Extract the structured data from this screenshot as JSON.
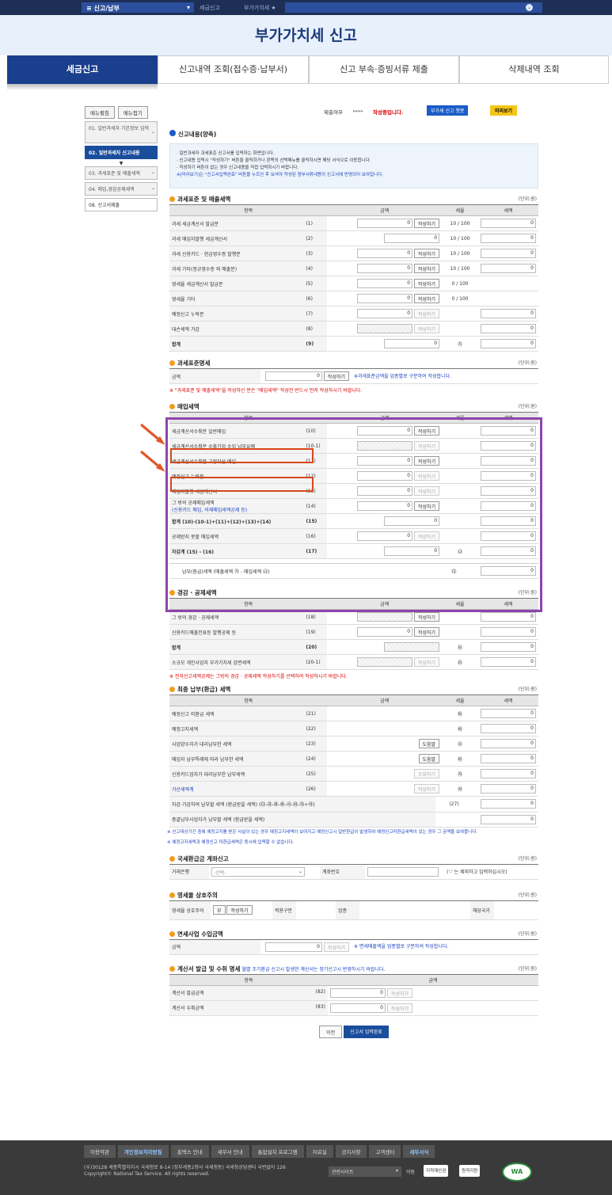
{
  "topbar": {
    "menu": "≡ 신고/납부",
    "crumb1": "세금신고",
    "crumb2": "부가가치세 ★"
  },
  "hero": {
    "title": "부가가치세 신고"
  },
  "tabs": [
    "세금신고",
    "신고내역 조회(접수증·납부서)",
    "신고 부속·증빙서류 제출",
    "삭제내역 조회"
  ],
  "leftnav": {
    "open": "메뉴펼침",
    "close": "메뉴접기",
    "items": [
      "01. 일반과세자 기본정보 입력",
      "02. 일반과세자 신고내용",
      "03. 과세표준 및 매출세액",
      "04. 매입,경감공제세액",
      "08. 신고서제출"
    ]
  },
  "status": {
    "label": "제출여부",
    "progress": "▸▸▸▸",
    "state": "작성중입니다.",
    "chatbot": "부가세 신고 챗봇",
    "preview": "미리보기"
  },
  "intro": {
    "title": "신고내용(양축)",
    "lines": [
      "· 일반과세자 과세표준 신고서를 입력하는 화면입니다.",
      "· 신고내용 입력시 \"작성하기\" 버튼을 클릭하거나 왼쪽의 선택메뉴를 클릭하시면 해당 서식으로 이동합니다.",
      "· 작성하기 버튼이 없는 경우 신고내용을 직접 입력하시기 바랍니다.",
      "※[미리보기]는 \"신고서입력완료\" 버튼을 누르신 후 보셔야 작성된 첨부서류내용이 신고서에 반영되어 보여집니다."
    ]
  },
  "unit": "(단위:원)",
  "headers": {
    "item": "항목",
    "amount": "금액",
    "rate": "세율",
    "tax": "세액"
  },
  "write": "작성하기",
  "help": "도움말",
  "inquire": "조회하기",
  "s1": {
    "title": "과세표준 및 매출세액",
    "rows": [
      [
        "과세 세금계산서 발급분",
        "(1)",
        "0",
        "w",
        "10 / 100",
        "0"
      ],
      [
        "과세 매입자발행 세금계산서",
        "(2)",
        "0",
        "",
        "10 / 100",
        "0"
      ],
      [
        "과세 신용카드 · 현금영수증 발행분",
        "(3)",
        "0",
        "w",
        "10 / 100",
        "0"
      ],
      [
        "과세 기타(정규영수증 외 매출분)",
        "(4)",
        "0",
        "w",
        "10 / 100",
        "0"
      ],
      [
        "영세율 세금계산서 발급분",
        "(5)",
        "0",
        "w",
        "0 / 100",
        ""
      ],
      [
        "영세율 기타",
        "(6)",
        "0",
        "w",
        "0 / 100",
        ""
      ],
      [
        "예정신고 누락분",
        "(7)",
        "0",
        "d",
        "",
        "0"
      ],
      [
        "대손세액 가감",
        "(8)",
        "",
        "d",
        "",
        "0"
      ],
      [
        "합계",
        "(9)",
        "0",
        "",
        "㉮",
        "0"
      ]
    ]
  },
  "s2": {
    "title": "과세표준명세",
    "label": "금액",
    "value": "0",
    "note": "※과세표준금액을 업종별로 구분하여 작성합니다.",
    "warn": "※ \"과세표준 및 매출세액\"을 작성하신 분은 \"매입세액\" 작성전 반드시 먼저 작성하시기 바랍니다."
  },
  "s3": {
    "title": "매입세액",
    "rows": [
      [
        "세금계산서수취분 일반매입",
        "(10)",
        "0",
        "w",
        "",
        "0"
      ],
      [
        "세금계산서수취분 수출기업 수입 납부유예",
        "(10-1)",
        "",
        "d",
        "",
        "0"
      ],
      [
        "세금계산서수취분 고정자산 매입",
        "(11)",
        "0",
        "w",
        "",
        "0"
      ],
      [
        "예정신고 누락분",
        "(12)",
        "0",
        "d",
        "",
        "0"
      ],
      [
        "매입자발행 세금계산서",
        "(13)",
        "0",
        "d",
        "",
        "0"
      ],
      [
        "그 밖의 공제매입세액",
        "(14)",
        "0",
        "w",
        "",
        "0"
      ],
      [
        "합계 (10)-(10-1)+(11)+(12)+(13)+(14)",
        "(15)",
        "0",
        "",
        "",
        "0"
      ],
      [
        "공제받지 못할 매입세액",
        "(16)",
        "0",
        "d",
        "",
        "0"
      ],
      [
        "차감계 (15) - (16)",
        "(17)",
        "0",
        "",
        "㉯",
        "0"
      ]
    ],
    "sub14": "(신용카드 매입, 의제매입세액공제 등)",
    "pay": "납부(환급)세액 (매출세액 ㉮ - 매입세액 ㉯)",
    "pay_mark": "㉰",
    "pay_val": "0"
  },
  "s4": {
    "title": "경감 · 공제세액",
    "rows": [
      [
        "그 밖의 경감 · 공제세액",
        "(18)",
        "",
        "w",
        "",
        "0"
      ],
      [
        "신용카드매출전표등 발행공제 등",
        "(19)",
        "0",
        "w",
        "",
        "0"
      ],
      [
        "합계",
        "(20)",
        "",
        "",
        "㉱",
        "0"
      ],
      [
        "소규모 개인사업자 부가가치세 감면세액",
        "(20-1)",
        "",
        "d",
        "㉱",
        "0"
      ]
    ],
    "warn": "※ 전자신고세액공제는 그밖의 경감 · 공제세액 작성하기를 선택하여 작성하시기 바랍니다."
  },
  "s5": {
    "title": "최종 납부(환급) 세액",
    "rows": [
      [
        "예정신고 미환급 세액",
        "(21)",
        "",
        "",
        "㉲",
        "0"
      ],
      [
        "예정고지세액",
        "(22)",
        "",
        "",
        "㉳",
        "0"
      ],
      [
        "사업양수자가 대리납부한 세액",
        "(23)",
        "",
        "h",
        "㉴",
        "0"
      ],
      [
        "매입자 납부특례에 따라 납부한 세액",
        "(24)",
        "",
        "h",
        "㉵",
        "0"
      ],
      [
        "신용카드업자가 대리납부한 납부세액",
        "(25)",
        "",
        "i",
        "㉶",
        "0"
      ],
      [
        "가산세액계",
        "(26)",
        "",
        "d",
        "㉷",
        "0"
      ]
    ],
    "r27": "차감·가감하여 납부할 세액 (환급받을 세액) (㉰-㉱-㉲-㉳-㉴-㉵-㉶+㉷)",
    "r27n": "(27)",
    "r27v": "0",
    "r28": "총괄납부사업자가 납부할 세액 (환급받을 세액)",
    "r28v": "0",
    "note1": "※ 신고대상기간 중에 예정고지를 받은 사실이 있는 경우 예정고지세액이 보여지고 예정신고시 일반환급이 발생하여 예정신고미환급세액이 있는 경우 그 금액을 보여줍니다.",
    "note2": "※ 예정고지세액과 예정신고 미환급세액은 동시에 입력할 수 없습니다."
  },
  "s6": {
    "title": "국세환급금 계좌신고",
    "bank": "거래은행",
    "bank_sel": "-선택-",
    "acct": "계좌번호",
    "acct_note": "('-' 는 제외하고 입력하십시오)"
  },
  "s7": {
    "title": "영세율 상호주의",
    "l1": "영세율 상호주의",
    "btn_val": "부",
    "l2": "적용구분",
    "l3": "업종",
    "l4": "해당국가"
  },
  "s8": {
    "title": "면세사업 수입금액",
    "label": "금액",
    "value": "0",
    "note": "※ 면세매출액을 업종별로 구분하여 작성합니다."
  },
  "s9": {
    "title": "계산서 발급 및 수취 명세",
    "subnote": "월별 조기환급 신고시 발생한 계산서는 정기신고시 반영하시기 바랍니다.",
    "rows": [
      [
        "계산서 발급금액",
        "(82)",
        "0"
      ],
      [
        "계산서 수취금액",
        "(83)",
        "0"
      ]
    ]
  },
  "buttons": {
    "prev": "이전",
    "done": "신고서 입력완료"
  },
  "footer": {
    "links": [
      "이용약관",
      "개인정보처리방침",
      "홈택스 안내",
      "세무서 안내",
      "통합설치 프로그램",
      "자료실",
      "공지사항",
      "고객센터",
      "세무서식"
    ],
    "addr1": "(우)30128 세종특별자치시 국세청로 8-14 (정부세종2청사 국세청동) 국세청상담센터 국번없이 126",
    "addr2": "Copyright© National Tax Service. All rights reserved.",
    "related": "관련사이트",
    "move": "이동",
    "b1": "지적재산권",
    "b2": "원격지원",
    "wa": "WA"
  }
}
